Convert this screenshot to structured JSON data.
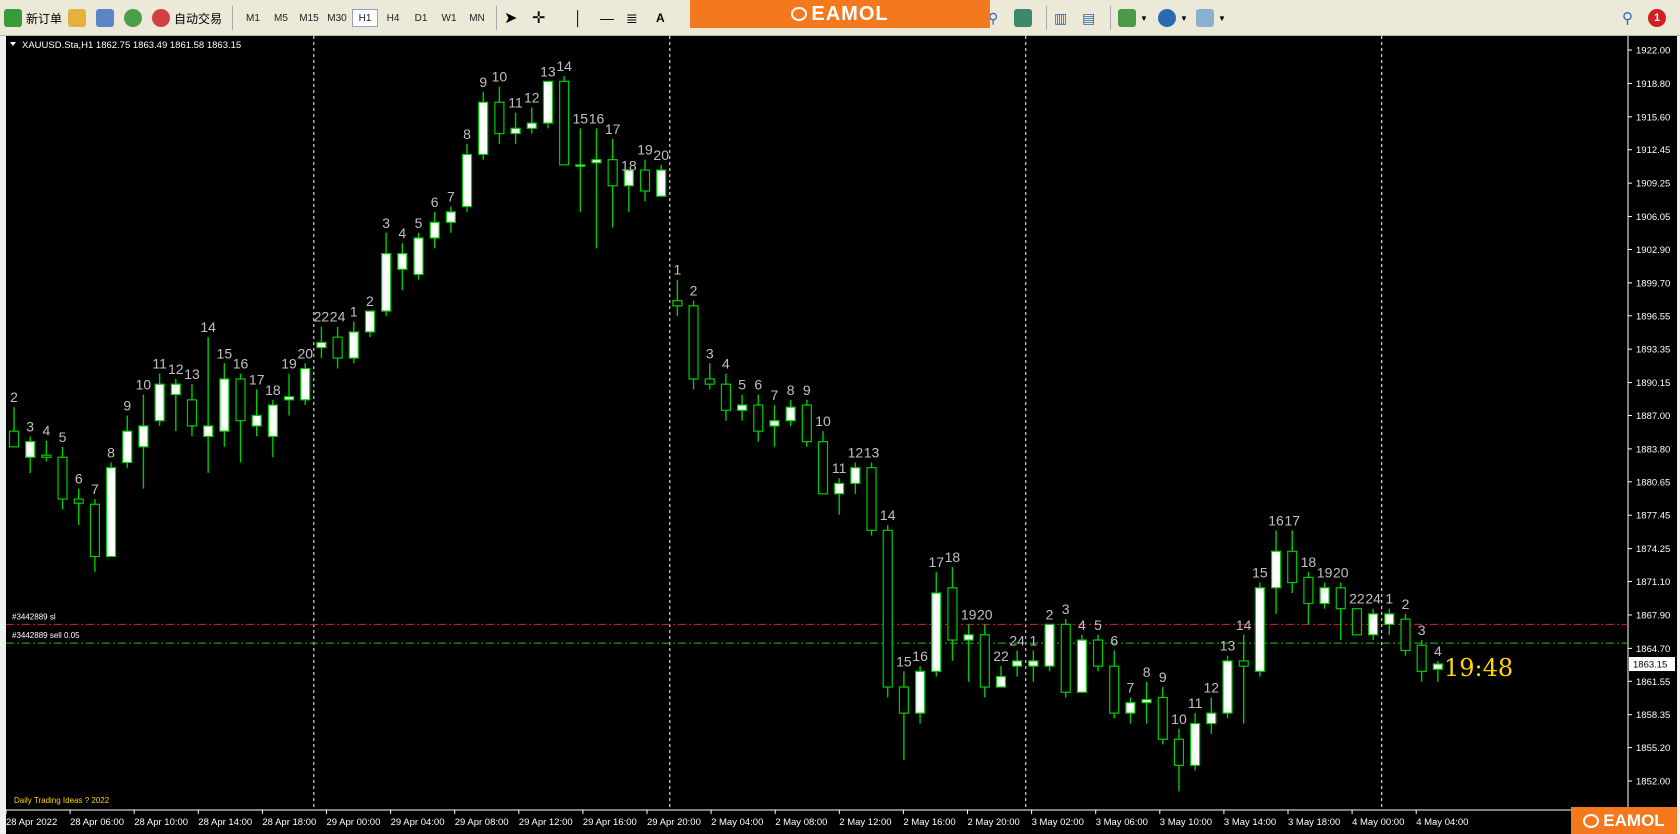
{
  "toolbar": {
    "new_order": "新订单",
    "auto_trade": "自动交易",
    "timeframes": [
      "M1",
      "M5",
      "M15",
      "M30",
      "H1",
      "H4",
      "D1",
      "W1",
      "MN"
    ],
    "active_timeframe": "H1",
    "text_tool": "A",
    "notification_count": "1"
  },
  "banner": {
    "logo_text": "EAMOL"
  },
  "corner_logo": {
    "logo_text": "EAMOL"
  },
  "chart": {
    "symbol_info": "XAUUSD.Sta,H1  1862.75 1863.49 1861.58 1863.15",
    "order_lines": {
      "sl_label": "#3442889 sl",
      "sell_label": "#3442889 sell 0.05",
      "sl_price": 1867.0,
      "entry_price": 1865.2
    },
    "current_price": "1863.15",
    "timer": "19:48",
    "watermark": "Daily Trading Ideas  ? 2022",
    "colors": {
      "bg": "#000000",
      "up_body": "#ffffff",
      "outline": "#00cc00",
      "sl_line": "#e02020",
      "entry_line": "#20c020",
      "axis_text": "#ffffff",
      "counter_text": "#c0c0c0",
      "timer": "#ffd700"
    },
    "price_ticks": [
      "1922.00",
      "1918.80",
      "1915.60",
      "1912.45",
      "1909.25",
      "1906.05",
      "1902.90",
      "1899.70",
      "1896.55",
      "1893.35",
      "1890.15",
      "1887.00",
      "1883.80",
      "1880.65",
      "1877.45",
      "1874.25",
      "1871.10",
      "1867.90",
      "1864.70",
      "1861.55",
      "1858.35",
      "1855.20",
      "1852.00"
    ],
    "time_labels": [
      "28 Apr 2022",
      "28 Apr 06:00",
      "28 Apr 10:00",
      "28 Apr 14:00",
      "28 Apr 18:00",
      "29 Apr 00:00",
      "29 Apr 04:00",
      "29 Apr 08:00",
      "29 Apr 12:00",
      "29 Apr 16:00",
      "29 Apr 20:00",
      "2 May 04:00",
      "2 May 08:00",
      "2 May 12:00",
      "2 May 16:00",
      "2 May 20:00",
      "3 May 02:00",
      "3 May 06:00",
      "3 May 10:00",
      "3 May 14:00",
      "3 May 18:00",
      "4 May 00:00",
      "4 May 04:00"
    ],
    "candles": [
      {
        "o": 1885.5,
        "h": 1887.8,
        "l": 1884.0,
        "c": 1884.0,
        "n": "2"
      },
      {
        "o": 1883.0,
        "h": 1885.0,
        "l": 1881.5,
        "c": 1884.5,
        "n": "3"
      },
      {
        "o": 1883.2,
        "h": 1884.6,
        "l": 1882.6,
        "c": 1883.0,
        "n": "4"
      },
      {
        "o": 1883.0,
        "h": 1884.0,
        "l": 1878.0,
        "c": 1879.0,
        "n": "5"
      },
      {
        "o": 1879.0,
        "h": 1880.0,
        "l": 1876.5,
        "c": 1878.6,
        "n": "6"
      },
      {
        "o": 1878.5,
        "h": 1879.0,
        "l": 1872.0,
        "c": 1873.5,
        "n": "7"
      },
      {
        "o": 1873.5,
        "h": 1882.5,
        "l": 1873.5,
        "c": 1882.0,
        "n": "8"
      },
      {
        "o": 1882.5,
        "h": 1887.0,
        "l": 1882.0,
        "c": 1885.5,
        "n": "9"
      },
      {
        "o": 1884.0,
        "h": 1889.0,
        "l": 1880.0,
        "c": 1886.0,
        "n": "10"
      },
      {
        "o": 1886.5,
        "h": 1891.0,
        "l": 1886.0,
        "c": 1890.0,
        "n": "11"
      },
      {
        "o": 1889.0,
        "h": 1890.5,
        "l": 1885.5,
        "c": 1890.0,
        "n": "12"
      },
      {
        "o": 1888.5,
        "h": 1890.0,
        "l": 1885.0,
        "c": 1886.0,
        "n": "13"
      },
      {
        "o": 1885.0,
        "h": 1894.5,
        "l": 1881.5,
        "c": 1886.0,
        "n": "14"
      },
      {
        "o": 1885.5,
        "h": 1892.0,
        "l": 1884.0,
        "c": 1890.5,
        "n": "15"
      },
      {
        "o": 1890.5,
        "h": 1891.0,
        "l": 1882.5,
        "c": 1886.5,
        "n": "16"
      },
      {
        "o": 1886.0,
        "h": 1889.5,
        "l": 1885.0,
        "c": 1887.0,
        "n": "17"
      },
      {
        "o": 1885.0,
        "h": 1888.5,
        "l": 1883.0,
        "c": 1888.0,
        "n": "18"
      },
      {
        "o": 1888.5,
        "h": 1891.0,
        "l": 1887.0,
        "c": 1888.8,
        "n": "19"
      },
      {
        "o": 1888.5,
        "h": 1892.0,
        "l": 1888.0,
        "c": 1891.5,
        "n": "20"
      },
      {
        "o": 1893.5,
        "h": 1895.5,
        "l": 1892.5,
        "c": 1894.0,
        "n": "22"
      },
      {
        "o": 1894.5,
        "h": 1895.5,
        "l": 1891.5,
        "c": 1892.5,
        "n": "24"
      },
      {
        "o": 1892.5,
        "h": 1896.0,
        "l": 1892.0,
        "c": 1895.0,
        "n": "1"
      },
      {
        "o": 1895.0,
        "h": 1897.0,
        "l": 1894.5,
        "c": 1897.0,
        "n": "2"
      },
      {
        "o": 1897.0,
        "h": 1904.5,
        "l": 1896.5,
        "c": 1902.5,
        "n": "3"
      },
      {
        "o": 1901.0,
        "h": 1903.5,
        "l": 1899.0,
        "c": 1902.5,
        "n": "4"
      },
      {
        "o": 1900.5,
        "h": 1904.5,
        "l": 1900.0,
        "c": 1904.0,
        "n": "5"
      },
      {
        "o": 1904.0,
        "h": 1906.5,
        "l": 1903.0,
        "c": 1905.5,
        "n": "6"
      },
      {
        "o": 1905.5,
        "h": 1907.0,
        "l": 1904.5,
        "c": 1906.5,
        "n": "7"
      },
      {
        "o": 1907.0,
        "h": 1913.0,
        "l": 1906.5,
        "c": 1912.0,
        "n": "8"
      },
      {
        "o": 1912.0,
        "h": 1918.0,
        "l": 1911.5,
        "c": 1917.0,
        "n": "9"
      },
      {
        "o": 1917.0,
        "h": 1918.5,
        "l": 1913.0,
        "c": 1914.0,
        "n": "10"
      },
      {
        "o": 1914.0,
        "h": 1916.0,
        "l": 1913.0,
        "c": 1914.5,
        "n": "11"
      },
      {
        "o": 1914.5,
        "h": 1916.5,
        "l": 1914.0,
        "c": 1915.0,
        "n": "12"
      },
      {
        "o": 1915.0,
        "h": 1919.0,
        "l": 1914.5,
        "c": 1919.0,
        "n": "13"
      },
      {
        "o": 1919.0,
        "h": 1919.5,
        "l": 1911.0,
        "c": 1911.0,
        "n": "14"
      },
      {
        "o": 1911.0,
        "h": 1914.5,
        "l": 1906.5,
        "c": 1911.0,
        "n": "15"
      },
      {
        "o": 1911.2,
        "h": 1914.5,
        "l": 1903.0,
        "c": 1911.5,
        "n": "16"
      },
      {
        "o": 1911.5,
        "h": 1913.5,
        "l": 1905.0,
        "c": 1909.0,
        "n": "17"
      },
      {
        "o": 1909.0,
        "h": 1910.0,
        "l": 1906.5,
        "c": 1910.5,
        "n": "18"
      },
      {
        "o": 1910.5,
        "h": 1911.5,
        "l": 1907.5,
        "c": 1908.5,
        "n": "19"
      },
      {
        "o": 1908.0,
        "h": 1911.0,
        "l": 1908.0,
        "c": 1910.5,
        "n": "20"
      },
      {
        "o": 1898.0,
        "h": 1900.0,
        "l": 1896.5,
        "c": 1897.5,
        "n": "1"
      },
      {
        "o": 1897.5,
        "h": 1898.0,
        "l": 1889.5,
        "c": 1890.5,
        "n": "2"
      },
      {
        "o": 1890.5,
        "h": 1892.0,
        "l": 1889.5,
        "c": 1890.0,
        "n": "3"
      },
      {
        "o": 1890.0,
        "h": 1891.0,
        "l": 1886.5,
        "c": 1887.5,
        "n": "4"
      },
      {
        "o": 1887.5,
        "h": 1889.0,
        "l": 1886.5,
        "c": 1888.0,
        "n": "5"
      },
      {
        "o": 1888.0,
        "h": 1889.0,
        "l": 1884.5,
        "c": 1885.5,
        "n": "6"
      },
      {
        "o": 1886.0,
        "h": 1888.0,
        "l": 1884.0,
        "c": 1886.5,
        "n": "7"
      },
      {
        "o": 1886.5,
        "h": 1888.5,
        "l": 1886.0,
        "c": 1887.8,
        "n": "8"
      },
      {
        "o": 1888.0,
        "h": 1888.5,
        "l": 1884.0,
        "c": 1884.5,
        "n": "9"
      },
      {
        "o": 1884.5,
        "h": 1885.5,
        "l": 1879.5,
        "c": 1879.5,
        "n": "10"
      },
      {
        "o": 1879.5,
        "h": 1881.0,
        "l": 1877.5,
        "c": 1880.5,
        "n": "11"
      },
      {
        "o": 1880.5,
        "h": 1882.5,
        "l": 1879.5,
        "c": 1882.0,
        "n": "12"
      },
      {
        "o": 1882.0,
        "h": 1882.5,
        "l": 1875.5,
        "c": 1876.0,
        "n": "13"
      },
      {
        "o": 1876.0,
        "h": 1876.5,
        "l": 1860.0,
        "c": 1861.0,
        "n": "14"
      },
      {
        "o": 1861.0,
        "h": 1862.5,
        "l": 1854.0,
        "c": 1858.5,
        "n": "15"
      },
      {
        "o": 1858.5,
        "h": 1863.0,
        "l": 1857.5,
        "c": 1862.5,
        "n": "16"
      },
      {
        "o": 1862.5,
        "h": 1872.0,
        "l": 1862.0,
        "c": 1870.0,
        "n": "17"
      },
      {
        "o": 1870.5,
        "h": 1872.5,
        "l": 1863.5,
        "c": 1865.5,
        "n": "18"
      },
      {
        "o": 1865.5,
        "h": 1867.0,
        "l": 1861.5,
        "c": 1866.0,
        "n": "19"
      },
      {
        "o": 1866.0,
        "h": 1867.0,
        "l": 1860.0,
        "c": 1861.0,
        "n": "20"
      },
      {
        "o": 1861.0,
        "h": 1863.0,
        "l": 1861.0,
        "c": 1862.0,
        "n": "22"
      },
      {
        "o": 1863.0,
        "h": 1864.5,
        "l": 1862.0,
        "c": 1863.5,
        "n": "24"
      },
      {
        "o": 1863.0,
        "h": 1864.5,
        "l": 1861.5,
        "c": 1863.5,
        "n": "1"
      },
      {
        "o": 1863.0,
        "h": 1867.0,
        "l": 1862.5,
        "c": 1867.0,
        "n": "2"
      },
      {
        "o": 1867.0,
        "h": 1867.5,
        "l": 1860.0,
        "c": 1860.5,
        "n": "3"
      },
      {
        "o": 1860.5,
        "h": 1866.0,
        "l": 1860.5,
        "c": 1865.5,
        "n": "4"
      },
      {
        "o": 1865.5,
        "h": 1866.0,
        "l": 1862.5,
        "c": 1863.0,
        "n": "5"
      },
      {
        "o": 1863.0,
        "h": 1864.5,
        "l": 1858.0,
        "c": 1858.5,
        "n": "6"
      },
      {
        "o": 1858.5,
        "h": 1860.0,
        "l": 1857.5,
        "c": 1859.5,
        "n": "7"
      },
      {
        "o": 1859.5,
        "h": 1861.5,
        "l": 1857.5,
        "c": 1859.8,
        "n": "8"
      },
      {
        "o": 1860.0,
        "h": 1861.0,
        "l": 1855.5,
        "c": 1856.0,
        "n": "9"
      },
      {
        "o": 1856.0,
        "h": 1857.0,
        "l": 1851.0,
        "c": 1853.5,
        "n": "10"
      },
      {
        "o": 1853.5,
        "h": 1858.5,
        "l": 1853.0,
        "c": 1857.5,
        "n": "11"
      },
      {
        "o": 1857.5,
        "h": 1860.0,
        "l": 1856.5,
        "c": 1858.5,
        "n": "12"
      },
      {
        "o": 1858.5,
        "h": 1864.0,
        "l": 1858.0,
        "c": 1863.5,
        "n": "13"
      },
      {
        "o": 1863.5,
        "h": 1866.0,
        "l": 1857.5,
        "c": 1863.0,
        "n": "14"
      },
      {
        "o": 1862.5,
        "h": 1871.0,
        "l": 1862.0,
        "c": 1870.5,
        "n": "15"
      },
      {
        "o": 1870.5,
        "h": 1876.0,
        "l": 1868.0,
        "c": 1874.0,
        "n": "16"
      },
      {
        "o": 1874.0,
        "h": 1876.0,
        "l": 1870.0,
        "c": 1871.0,
        "n": "17"
      },
      {
        "o": 1871.5,
        "h": 1872.0,
        "l": 1867.0,
        "c": 1869.0,
        "n": "18"
      },
      {
        "o": 1869.0,
        "h": 1871.0,
        "l": 1868.5,
        "c": 1870.5,
        "n": "19"
      },
      {
        "o": 1870.5,
        "h": 1871.0,
        "l": 1865.5,
        "c": 1868.5,
        "n": "20"
      },
      {
        "o": 1868.5,
        "h": 1868.5,
        "l": 1866.0,
        "c": 1866.0,
        "n": "22"
      },
      {
        "o": 1866.0,
        "h": 1868.5,
        "l": 1865.5,
        "c": 1868.0,
        "n": "24"
      },
      {
        "o": 1867.0,
        "h": 1868.5,
        "l": 1866.0,
        "c": 1868.0,
        "n": "1"
      },
      {
        "o": 1867.5,
        "h": 1868.0,
        "l": 1864.0,
        "c": 1864.5,
        "n": "2"
      },
      {
        "o": 1865.0,
        "h": 1865.5,
        "l": 1861.5,
        "c": 1862.5,
        "n": "3"
      },
      {
        "o": 1862.7,
        "h": 1863.5,
        "l": 1861.5,
        "c": 1863.2,
        "n": "4"
      }
    ]
  }
}
